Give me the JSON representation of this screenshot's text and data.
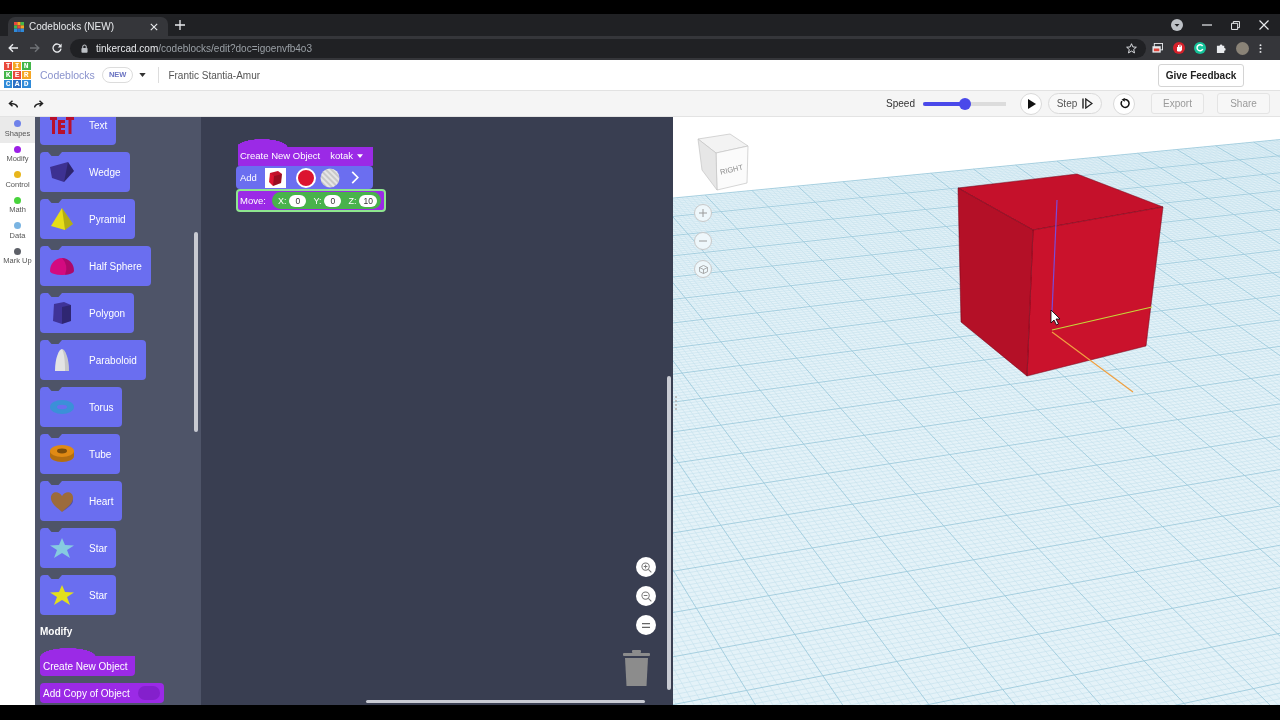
{
  "browser": {
    "tab": {
      "title": "Codeblocks (NEW)"
    },
    "address": {
      "host": "tinkercad.com",
      "path": "/codeblocks/edit?doc=igoenvfb4o3"
    },
    "forward_button": {
      "disabled": true
    }
  },
  "header": {
    "logo": [
      "TIN",
      "KER",
      "CAD"
    ],
    "app_name": "Codeblocks",
    "badge": "NEW",
    "project_name": "Frantic Stantia-Amur",
    "feedback_button": "Give Feedback"
  },
  "toolbar": {
    "speed_label": "Speed",
    "speed_slider": {
      "level": 0.5
    },
    "step_button": "Step",
    "buttons": [
      {
        "label": "Export",
        "disabled": true
      },
      {
        "label": "Share",
        "disabled": true
      }
    ]
  },
  "categories": [
    {
      "label": "Shapes",
      "color": "#6f82ea",
      "selected": true
    },
    {
      "label": "Modify",
      "color": "#9b1fe6",
      "selected": false
    },
    {
      "label": "Control",
      "color": "#e8b61c",
      "selected": false
    },
    {
      "label": "Math",
      "color": "#48d33c",
      "selected": false
    },
    {
      "label": "Data",
      "color": "#7ab4e2",
      "selected": false
    },
    {
      "label": "Mark Up",
      "color": "#5d6068",
      "selected": false
    }
  ],
  "palette": {
    "shape_blocks": [
      {
        "label": "Text",
        "kind": "text",
        "color": "#b8102c"
      },
      {
        "label": "Wedge",
        "kind": "wedge",
        "color": "#3d3192"
      },
      {
        "label": "Pyramid",
        "kind": "pyramid",
        "color": "#e6de18"
      },
      {
        "label": "Half Sphere",
        "kind": "hemisphere",
        "color": "#d40a80"
      },
      {
        "label": "Polygon",
        "kind": "polygon",
        "color": "#3f3398"
      },
      {
        "label": "Paraboloid",
        "kind": "paraboloid",
        "color": "#e4e4e4"
      },
      {
        "label": "Torus",
        "kind": "torus",
        "color": "#3b90d8"
      },
      {
        "label": "Tube",
        "kind": "tube",
        "color": "#e08a14"
      },
      {
        "label": "Heart",
        "kind": "heart",
        "color": "#9c6b3c"
      },
      {
        "label": "Star",
        "kind": "star",
        "color": "#86cbe0"
      },
      {
        "label": "Star",
        "kind": "star",
        "color": "#e2df1c"
      }
    ],
    "section_title": "Modify",
    "modify_blocks": [
      {
        "label": "Create New Object",
        "kind": "hat"
      },
      {
        "label": "Add Copy of Object",
        "kind": "socket"
      }
    ]
  },
  "workspace": {
    "blocks": [
      {
        "kind": "create",
        "label": "Create New Object",
        "dropdown": "kotak",
        "selected": false
      },
      {
        "kind": "add",
        "label": "Add",
        "color": "#dc1430",
        "selected": false
      },
      {
        "kind": "move",
        "label": "Move:",
        "fields": [
          {
            "label": "X:",
            "value": "0"
          },
          {
            "label": "Y:",
            "value": "0"
          },
          {
            "label": "Z:",
            "value": "10"
          }
        ],
        "selected": true
      }
    ]
  },
  "viewport": {
    "view_cube_label": "RIGHT"
  }
}
